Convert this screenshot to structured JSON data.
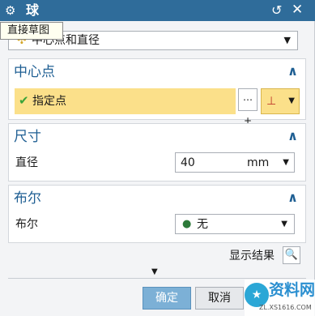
{
  "window": {
    "title": "球",
    "reset_icon": "↺",
    "close_icon": "✕"
  },
  "tooltip": {
    "text": "直接草图"
  },
  "type": {
    "value": "中心点和直径"
  },
  "center_group": {
    "title": "中心点",
    "specify_label": "指定点"
  },
  "size_group": {
    "title": "尺寸",
    "diameter_label": "直径",
    "diameter_value": "40",
    "diameter_unit": "mm"
  },
  "boolean_group": {
    "title": "布尔",
    "boolean_label": "布尔",
    "boolean_value": "无"
  },
  "preview": {
    "label": "显示结果"
  },
  "actions": {
    "ok_label": "确定",
    "cancel_label": "取消"
  },
  "watermark": {
    "brand": "资料网",
    "url": "ZL.XS1616.COM",
    "logo": "★"
  },
  "colors": {
    "title_bar": "#2f6c9a",
    "group_title": "#1f5f93",
    "highlight": "#fbe08a",
    "ok_button": "#7cb0d6"
  }
}
